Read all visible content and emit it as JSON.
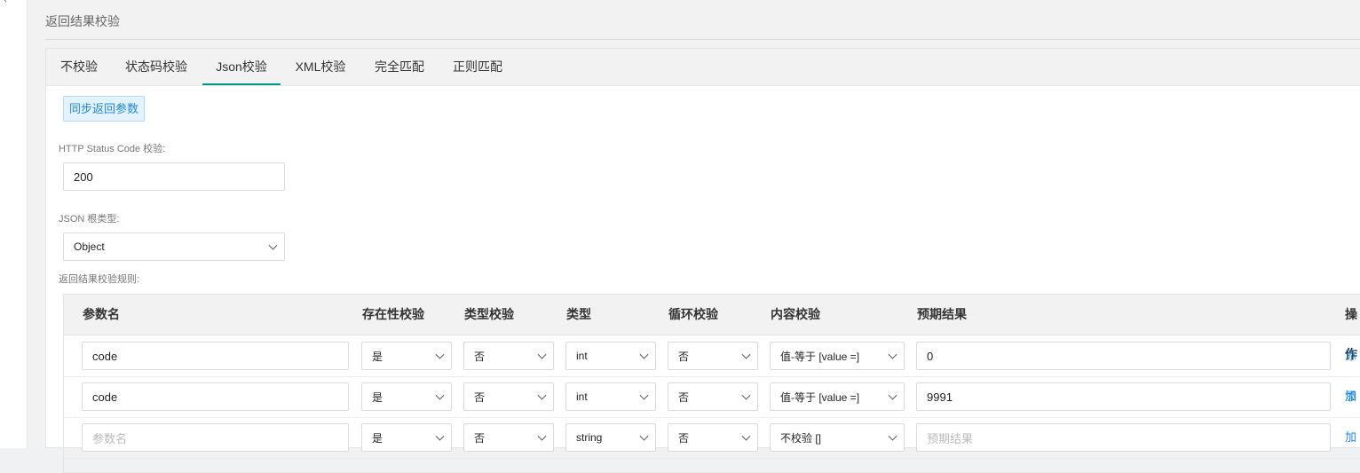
{
  "section_title": "返回结果校验",
  "tabs": [
    {
      "label": "不校验"
    },
    {
      "label": "状态码校验"
    },
    {
      "label": "Json校验"
    },
    {
      "label": "XML校验"
    },
    {
      "label": "完全匹配"
    },
    {
      "label": "正则匹配"
    }
  ],
  "active_tab": "Json校验",
  "sync_button": "同步返回参数",
  "status_code": {
    "label": "HTTP Status Code 校验:",
    "value": "200"
  },
  "json_root": {
    "label": "JSON 根类型:",
    "value": "Object"
  },
  "rules_label": "返回结果校验规则:",
  "table": {
    "headers": [
      "参数名",
      "存在性校验",
      "类型校验",
      "类型",
      "循环校验",
      "内容校验",
      "预期结果",
      "操作"
    ],
    "rows": [
      {
        "param": "code",
        "exists": "是",
        "type_check": "否",
        "type": "int",
        "loop": "否",
        "content": "值-等于 [value =]",
        "expected": "0",
        "action": "添加"
      },
      {
        "param": "code",
        "exists": "是",
        "type_check": "否",
        "type": "int",
        "loop": "否",
        "content": "值-等于 [value =]",
        "expected": "9991",
        "action": "添加"
      },
      {
        "param_placeholder": "参数名",
        "exists": "是",
        "type_check": "否",
        "type": "string",
        "loop": "否",
        "content": "不校验 []",
        "expected_placeholder": "预期结果"
      }
    ]
  }
}
